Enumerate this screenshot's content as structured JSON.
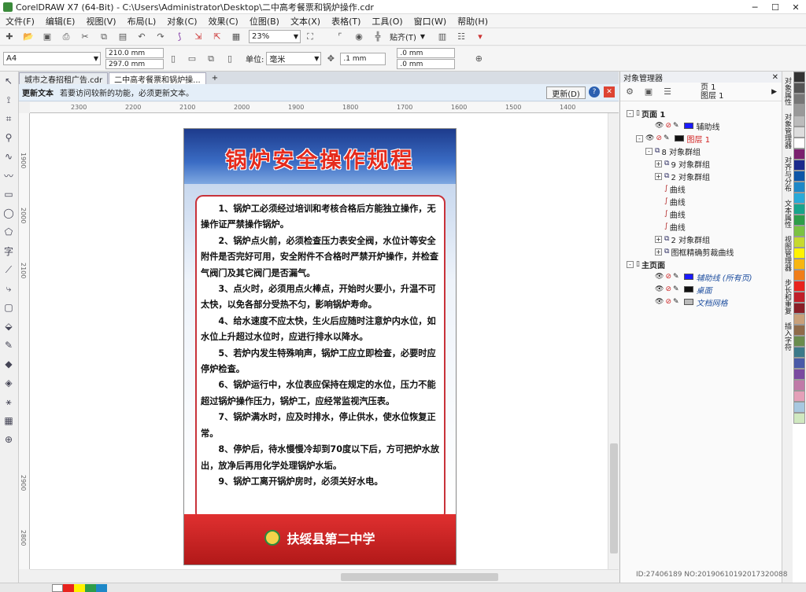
{
  "window": {
    "title": "CorelDRAW X7 (64-Bit) - C:\\Users\\Administrator\\Desktop\\二中高考餐票和锅炉操作.cdr"
  },
  "menu": [
    "文件(F)",
    "编辑(E)",
    "视图(V)",
    "布局(L)",
    "对象(C)",
    "效果(C)",
    "位图(B)",
    "文本(X)",
    "表格(T)",
    "工具(O)",
    "窗口(W)",
    "帮助(H)"
  ],
  "toolbar": {
    "zoom": "23%",
    "snap": "贴齐(T)"
  },
  "propbar": {
    "page_size": "A4",
    "width": "210.0 mm",
    "height": "297.0 mm",
    "unit_label": "单位:",
    "unit": "毫米",
    "nudge": ".1 mm",
    "dup_x": ".0 mm",
    "dup_y": ".0 mm"
  },
  "tabs": [
    "城市之春招租广告.cdr",
    "二中高考餐票和锅炉操..."
  ],
  "infobar": {
    "label": "更新文本",
    "message": "若要访问较新的功能，必须更新文本。",
    "button": "更新(D)"
  },
  "ruler": {
    "h": [
      "2300",
      "2200",
      "2100",
      "2000",
      "1900",
      "1800",
      "1700",
      "1600",
      "1500",
      "1400"
    ],
    "v": [
      "1900",
      "2000",
      "2100",
      "2900",
      "2800"
    ]
  },
  "poster": {
    "title": "锅炉安全操作规程",
    "rules": [
      "1、锅炉工必须经过培训和考核合格后方能独立操作，无操作证严禁操作锅炉。",
      "2、锅炉点火前，必须检查压力表安全阀，水位计等安全附件是否完好可用，安全附件不合格时严禁开炉操作，并检查气阀门及其它阀门是否漏气。",
      "3、点火时，必须用点火棒点，开始时火要小，升温不可太快，以免各部分受热不匀，影响锅炉寿命。",
      "4、给水速度不应太快，生火后应随时注意炉内水位，如水位上升超过水位时，应进行排水以降水。",
      "5、若炉内发生特殊响声，锅炉工应立即检查，必要时应停炉检查。",
      "6、锅炉运行中，水位表应保持在规定的水位，压力不能超过锅炉操作压力，锅炉工，应经常监视汽压表。",
      "7、锅炉满水时，应及时排水，停止供水，使水位恢复正常。",
      "8、停炉后，待水慢慢冷却到70度以下后，方可把炉水放出，放净后再用化学处理锅炉水垢。",
      "9、锅炉工离开锅炉房时，必须关好水电。"
    ],
    "school": "扶绥县第二中学"
  },
  "objmgr": {
    "title": "对象管理器",
    "page": "页 1",
    "layer": "图层 1",
    "nodes": [
      {
        "label": "页面 1",
        "indent": 0,
        "exp": "-"
      },
      {
        "label": "辅助线",
        "indent": 3,
        "swatch": "#1a1aff"
      },
      {
        "label": "图层 1",
        "indent": 1,
        "exp": "-",
        "swatch": "#111111",
        "red": true
      },
      {
        "label": "8 对象群组",
        "indent": 2,
        "exp": "-"
      },
      {
        "label": "9 对象群组",
        "indent": 3,
        "exp": "+"
      },
      {
        "label": "2 对象群组",
        "indent": 3,
        "exp": "+"
      },
      {
        "label": "曲线",
        "indent": 4
      },
      {
        "label": "曲线",
        "indent": 4
      },
      {
        "label": "曲线",
        "indent": 4
      },
      {
        "label": "曲线",
        "indent": 4
      },
      {
        "label": "2 对象群组",
        "indent": 3,
        "exp": "+"
      },
      {
        "label": "图框精确剪裁曲线",
        "indent": 3,
        "exp": "+"
      },
      {
        "label": "主页面",
        "indent": 0,
        "exp": "-"
      },
      {
        "label": "辅助线 (所有页)",
        "indent": 3,
        "swatch": "#1a1aff",
        "italic": true
      },
      {
        "label": "桌面",
        "indent": 3,
        "swatch": "#111111",
        "italic": true
      },
      {
        "label": "文档网格",
        "indent": 3,
        "swatch": "#bbbbbb",
        "italic": true
      }
    ]
  },
  "dock_tabs": [
    "对象属性",
    "对象管理器",
    "对齐与分布",
    "文本属性",
    "视图管理器",
    "步长和重复",
    "插入字符"
  ],
  "palette": [
    "#333333",
    "#555555",
    "#777777",
    "#999999",
    "#bbbbbb",
    "#dddddd",
    "#ffffff",
    "#7a1f6e",
    "#1b2a8c",
    "#0e56a8",
    "#1e88c8",
    "#2aaad8",
    "#18a48c",
    "#2e9d4a",
    "#7cc242",
    "#c6d92f",
    "#fff200",
    "#f7b612",
    "#f07e1a",
    "#e8231d",
    "#c0202a",
    "#8a1f28",
    "#c8a07a",
    "#8f6b4a",
    "#6a8c4e",
    "#3c7a8a",
    "#4a5aa8",
    "#7a4aa0",
    "#c07aa8",
    "#e4a0b8",
    "#a8c8e0",
    "#d0e8c0"
  ],
  "status": {
    "watermark": "ID:27406189 NO:20190610192017320088"
  }
}
